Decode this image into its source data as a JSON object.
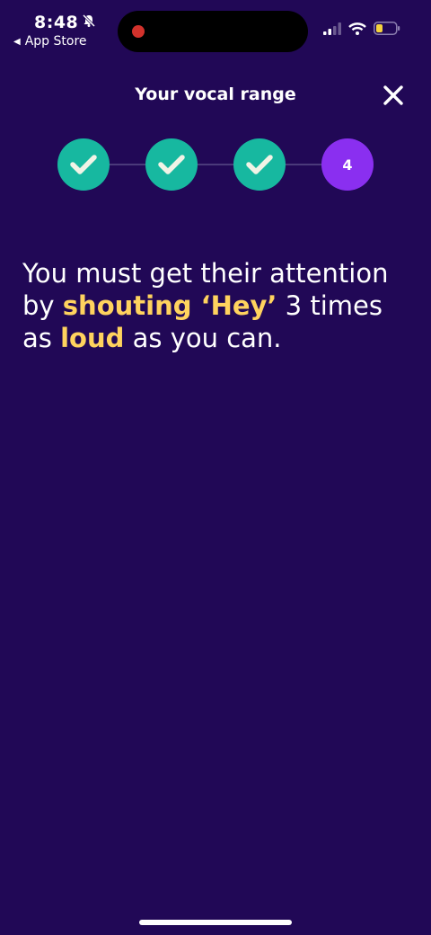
{
  "status_bar": {
    "time": "8:48",
    "back_label": "App Store",
    "icons": [
      "bell-slash-icon",
      "signal-icon",
      "wifi-icon",
      "battery-icon"
    ]
  },
  "header": {
    "title": "Your vocal range",
    "close_icon": "close-icon"
  },
  "stepper": {
    "steps": [
      {
        "state": "done",
        "icon": "check-icon"
      },
      {
        "state": "done",
        "icon": "check-icon"
      },
      {
        "state": "done",
        "icon": "check-icon"
      },
      {
        "state": "current",
        "label": "4"
      }
    ]
  },
  "instruction": {
    "part1": "You must get their attention by ",
    "highlight1": "shouting ‘Hey’",
    "part2": " 3 times as ",
    "highlight2": "loud",
    "part3": " as you can."
  },
  "colors": {
    "background": "#210856",
    "step_done": "#17b8a0",
    "step_current": "#8a2ff0",
    "highlight": "#ffd35e"
  }
}
